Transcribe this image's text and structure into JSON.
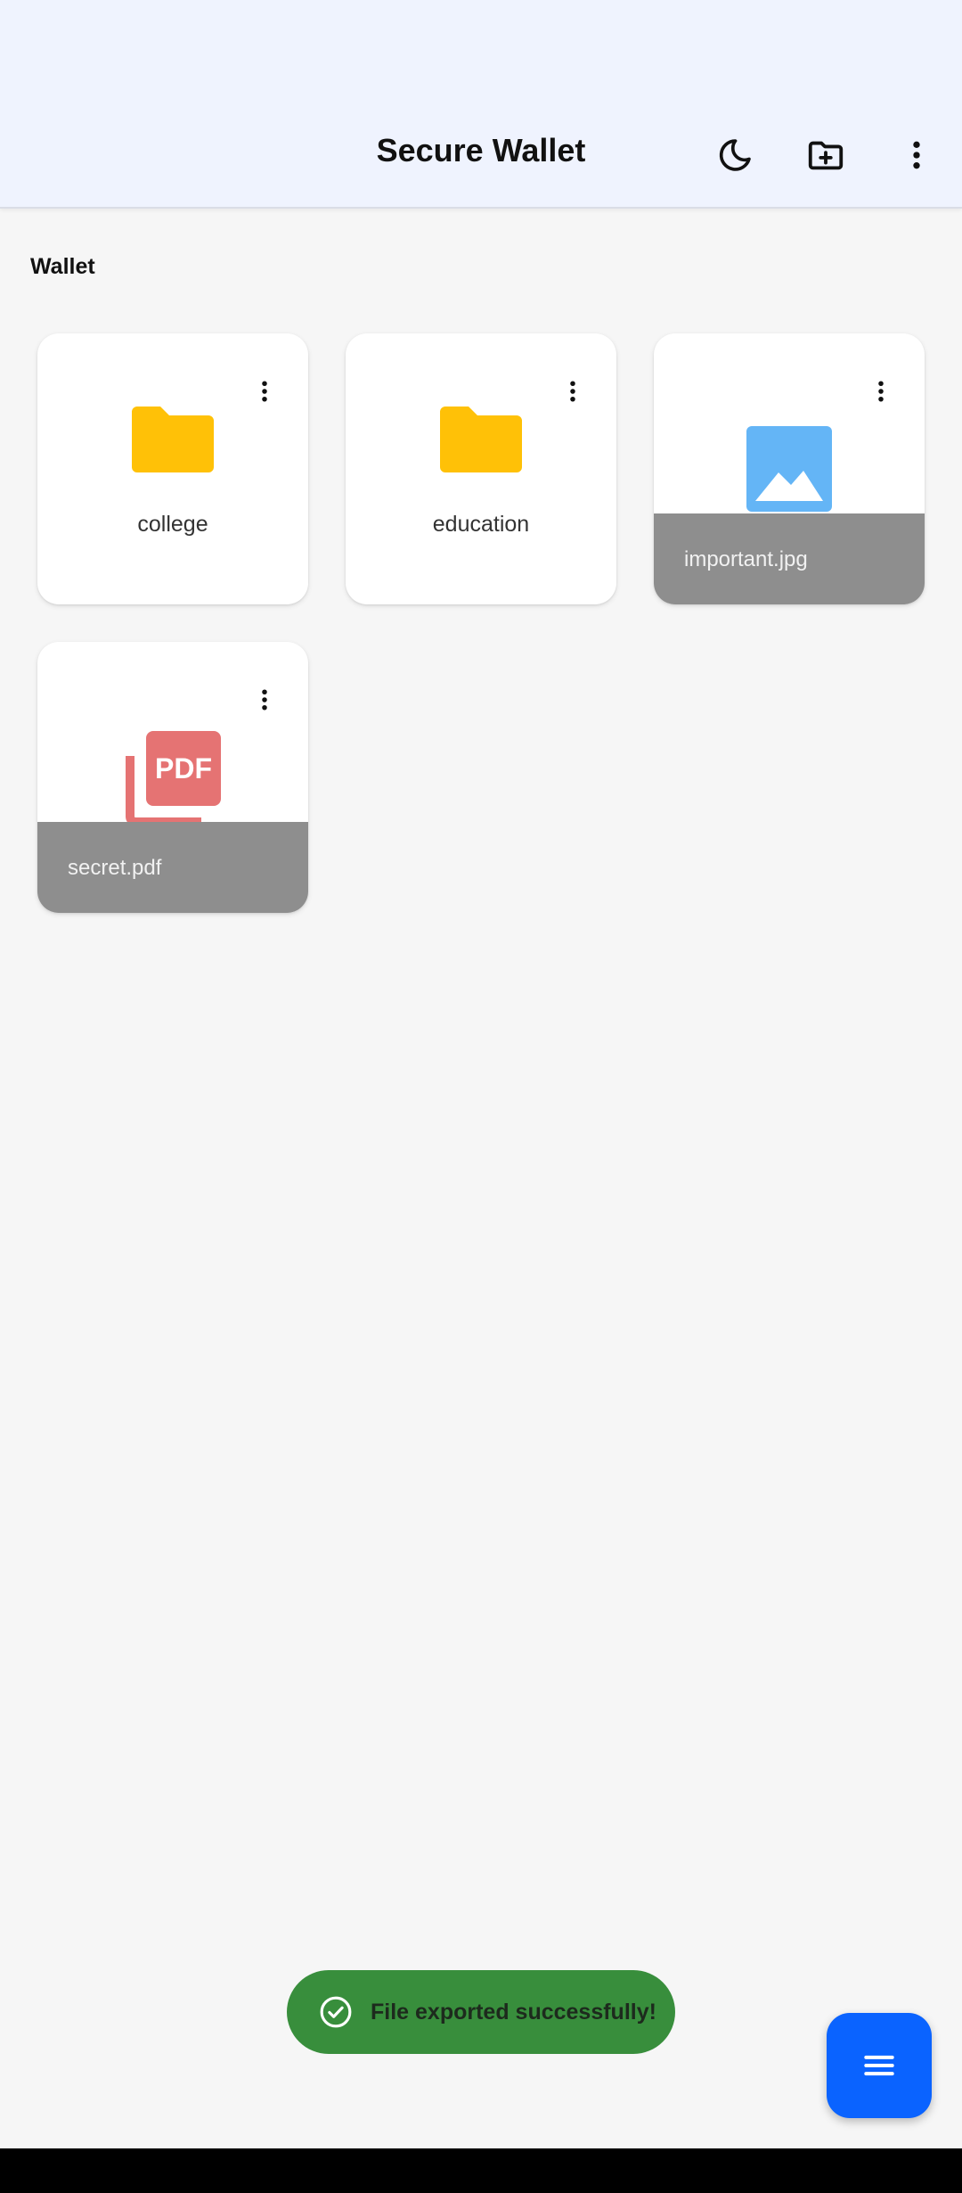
{
  "app_bar": {
    "title": "Secure Wallet",
    "actions": [
      "moon-icon",
      "create-new-folder-icon",
      "more-vert-icon"
    ]
  },
  "section": {
    "title": "Wallet"
  },
  "items": [
    {
      "type": "folder",
      "name": "college",
      "icon": "folder-icon",
      "color": "#FFC107"
    },
    {
      "type": "folder",
      "name": "education",
      "icon": "folder-icon",
      "color": "#FFC107"
    },
    {
      "type": "image",
      "name": "important.jpg",
      "icon": "image-icon",
      "color": "#64B5F6"
    },
    {
      "type": "pdf",
      "name": "secret.pdf",
      "icon": "pdf-icon",
      "color": "#E57373"
    }
  ],
  "snackbar": {
    "text": "File exported successfully!",
    "icon": "check-circle-icon",
    "color": "#388E3C"
  },
  "fab": {
    "icon": "menu-icon",
    "color": "#0A63FF"
  }
}
